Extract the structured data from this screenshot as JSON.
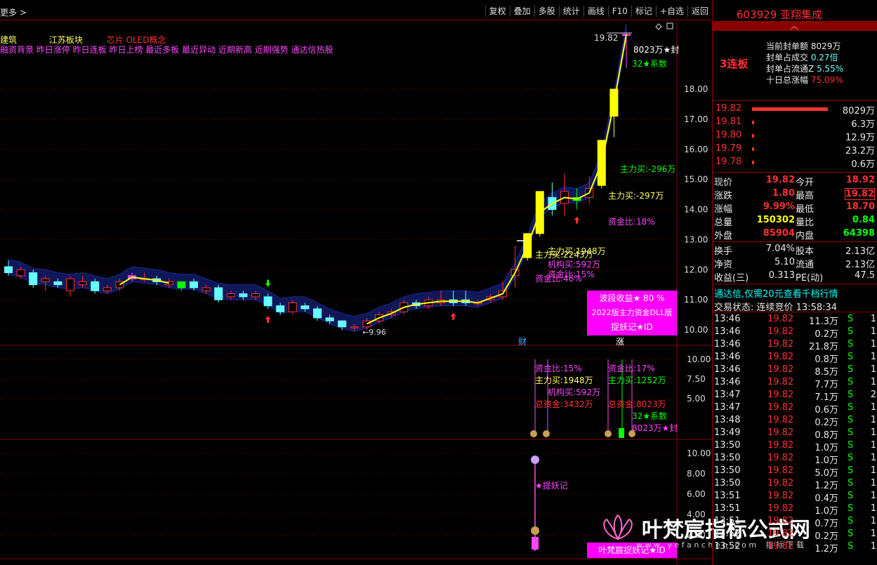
{
  "toolbar": {
    "more_label": "更多 >",
    "buttons": [
      "复权",
      "叠加",
      "多股",
      "统计",
      "画线",
      "F10",
      "标记",
      "+自选",
      "返回"
    ]
  },
  "chart": {
    "tags_row1": [
      "建筑",
      "江苏板块",
      "芯片 OLED概念"
    ],
    "tags_row2": "融资背景 昨日涨停 昨日连板 昨日上榜 最近多板 最近异动 近期新高 近期强势 通达信热股",
    "y_main_ticks": [
      "18.00",
      "17.00",
      "16.00",
      "15.00",
      "14.00",
      "13.00",
      "12.00",
      "11.00",
      "10.00"
    ],
    "y_mid_ticks": [
      "10.00",
      "7.50",
      "5.00"
    ],
    "y_bottom_ticks": [
      "10.00",
      "8.00",
      "6.00",
      "4.00",
      "2.00"
    ],
    "labels": {
      "high_price": "19.82",
      "seal_amount": "8023万★封",
      "coefficient": "32★系数",
      "low_price": "←9.96",
      "main_buy_1": "主力买:-296万",
      "main_buy_2": "主力买:-297万",
      "fund_ratio_1": "资金比:18%",
      "main_buy_3": "主力买:2243万",
      "main_buy_4": "主力买:1948万",
      "inst_buy": "机构买:592万",
      "fund_ratio_2": "资金比:15%",
      "fund_ratio_3": "资金比:46%",
      "cai": "财",
      "zhang": "涨",
      "mid_fund": "资金比:15%",
      "mid_main": "主力买:1948万",
      "mid_inst": "机构买:592万",
      "mid_total": "总资金:3432万",
      "mid_fund2": "资金比:17%",
      "mid_main2": "主力买:1252万",
      "mid_total2": "总资金:8023万",
      "mid_coef": "32★系数",
      "mid_seal": "8023万★封",
      "tiyao": "★提妖记"
    },
    "pinkbox": {
      "line1": "波段收益★ 80 %",
      "line2": "2022版主力资金DLL版",
      "line3": "捉妖记★ID"
    },
    "bottom_box": "叶梵宸捉妖记★ID",
    "watermark": "叶梵宸指标公式网",
    "watermark_sub": "w w w . y e f a n c h e n . c o m",
    "watermark_sub2": "指 标 下 载"
  },
  "chart_data": {
    "type": "candlestick",
    "ylim": [
      9.6,
      20.2
    ],
    "candles": [
      {
        "o": 11.9,
        "c": 12.1,
        "h": 12.3,
        "l": 11.8,
        "col": "cyan"
      },
      {
        "o": 11.8,
        "c": 12.0,
        "h": 12.1,
        "l": 11.7,
        "col": "red"
      },
      {
        "o": 11.9,
        "c": 11.5,
        "h": 12.0,
        "l": 11.4,
        "col": "cyan"
      },
      {
        "o": 11.6,
        "c": 11.7,
        "h": 11.8,
        "l": 11.3,
        "col": "red"
      },
      {
        "o": 11.6,
        "c": 11.5,
        "h": 11.7,
        "l": 11.4,
        "col": "cyan"
      },
      {
        "o": 11.7,
        "c": 11.3,
        "h": 11.8,
        "l": 11.1,
        "col": "red"
      },
      {
        "o": 11.5,
        "c": 11.6,
        "h": 11.8,
        "l": 11.4,
        "col": "red"
      },
      {
        "o": 11.6,
        "c": 11.3,
        "h": 11.7,
        "l": 11.2,
        "col": "cyan"
      },
      {
        "o": 11.4,
        "c": 11.3,
        "h": 11.5,
        "l": 11.2,
        "col": "red"
      },
      {
        "o": 11.4,
        "c": 11.6,
        "h": 11.7,
        "l": 11.3,
        "col": "red"
      },
      {
        "o": 11.7,
        "c": 11.8,
        "h": 11.9,
        "l": 11.6,
        "col": "magenta"
      },
      {
        "o": 11.7,
        "c": 11.7,
        "h": 11.9,
        "l": 11.6,
        "col": "red"
      },
      {
        "o": 11.7,
        "c": 11.6,
        "h": 11.8,
        "l": 11.5,
        "col": "cyan"
      },
      {
        "o": 11.6,
        "c": 11.5,
        "h": 11.7,
        "l": 11.4,
        "col": "red"
      },
      {
        "o": 11.6,
        "c": 11.4,
        "h": 11.6,
        "l": 11.3,
        "col": "green"
      },
      {
        "o": 11.6,
        "c": 11.4,
        "h": 11.7,
        "l": 11.3,
        "col": "cyan"
      },
      {
        "o": 11.4,
        "c": 11.3,
        "h": 11.5,
        "l": 11.2,
        "col": "red"
      },
      {
        "o": 11.4,
        "c": 11.0,
        "h": 11.5,
        "l": 10.9,
        "col": "cyan"
      },
      {
        "o": 11.1,
        "c": 11.2,
        "h": 11.3,
        "l": 11.0,
        "col": "red"
      },
      {
        "o": 11.2,
        "c": 11.1,
        "h": 11.3,
        "l": 11.0,
        "col": "cyan"
      },
      {
        "o": 11.2,
        "c": 11.1,
        "h": 11.3,
        "l": 11.0,
        "col": "red"
      },
      {
        "o": 11.1,
        "c": 10.8,
        "h": 11.2,
        "l": 10.7,
        "col": "cyan"
      },
      {
        "o": 10.8,
        "c": 10.6,
        "h": 10.9,
        "l": 10.5,
        "col": "cyan"
      },
      {
        "o": 10.6,
        "c": 10.9,
        "h": 11.0,
        "l": 10.5,
        "col": "red"
      },
      {
        "o": 10.8,
        "c": 10.7,
        "h": 10.9,
        "l": 10.6,
        "col": "cyan"
      },
      {
        "o": 10.7,
        "c": 10.4,
        "h": 10.8,
        "l": 10.3,
        "col": "cyan"
      },
      {
        "o": 10.4,
        "c": 10.3,
        "h": 10.5,
        "l": 10.2,
        "col": "cyan"
      },
      {
        "o": 10.3,
        "c": 10.1,
        "h": 10.3,
        "l": 10.0,
        "col": "cyan"
      },
      {
        "o": 10.1,
        "c": 10.1,
        "h": 10.2,
        "l": 9.96,
        "col": "red"
      },
      {
        "o": 10.1,
        "c": 10.3,
        "h": 10.4,
        "l": 10.0,
        "col": "red"
      },
      {
        "o": 10.3,
        "c": 10.5,
        "h": 10.6,
        "l": 10.2,
        "col": "red"
      },
      {
        "o": 10.5,
        "c": 10.6,
        "h": 10.7,
        "l": 10.4,
        "col": "red"
      },
      {
        "o": 10.6,
        "c": 10.9,
        "h": 11.0,
        "l": 10.5,
        "col": "red"
      },
      {
        "o": 10.9,
        "c": 10.8,
        "h": 11.0,
        "l": 10.7,
        "col": "cyan"
      },
      {
        "o": 10.8,
        "c": 11.0,
        "h": 11.1,
        "l": 10.7,
        "col": "red"
      },
      {
        "o": 10.9,
        "c": 11.0,
        "h": 11.3,
        "l": 10.8,
        "col": "red"
      },
      {
        "o": 11.0,
        "c": 10.9,
        "h": 11.3,
        "l": 10.8,
        "col": "cyan"
      },
      {
        "o": 11.0,
        "c": 10.9,
        "h": 11.3,
        "l": 10.8,
        "col": "cyan"
      },
      {
        "o": 10.9,
        "c": 10.9,
        "h": 11.0,
        "l": 10.8,
        "col": "red"
      },
      {
        "o": 11.0,
        "c": 11.1,
        "h": 11.2,
        "l": 10.9,
        "col": "red"
      },
      {
        "o": 11.1,
        "c": 11.3,
        "h": 11.6,
        "l": 11.0,
        "col": "red"
      },
      {
        "o": 11.8,
        "c": 12.0,
        "h": 12.8,
        "l": 11.4,
        "col": "red"
      },
      {
        "o": 12.4,
        "c": 13.2,
        "h": 13.2,
        "l": 12.3,
        "col": "yellow"
      },
      {
        "o": 13.2,
        "c": 14.6,
        "h": 14.6,
        "l": 13.1,
        "col": "yellow"
      },
      {
        "o": 14.4,
        "c": 14.0,
        "h": 14.9,
        "l": 13.8,
        "col": "cyan"
      },
      {
        "o": 14.2,
        "c": 14.6,
        "h": 15.2,
        "l": 13.8,
        "col": "red"
      },
      {
        "o": 14.4,
        "c": 14.3,
        "h": 14.7,
        "l": 14.0,
        "col": "green"
      },
      {
        "o": 14.4,
        "c": 14.7,
        "h": 15.1,
        "l": 14.2,
        "col": "red"
      },
      {
        "o": 14.8,
        "c": 16.3,
        "h": 16.3,
        "l": 14.7,
        "col": "yellow"
      },
      {
        "o": 17.1,
        "c": 18.0,
        "h": 18.0,
        "l": 16.4,
        "col": "yellow"
      },
      {
        "o": 19.82,
        "c": 19.82,
        "h": 19.82,
        "l": 18.7,
        "col": "magenta"
      }
    ]
  },
  "panel": {
    "code": "603929",
    "name": "亚翔集成",
    "board_count": "3连板",
    "seal_label": "当前封单额",
    "seal_value": "8029万",
    "deal_ratio_label": "封单占成交",
    "deal_ratio_value": "0.27倍",
    "float_ratio_label": "封单占流通Z",
    "float_ratio_value": "5.55%",
    "ten_day_label": "十日总涨幅",
    "ten_day_value": "75.09%",
    "order_book": [
      {
        "price": "19.82",
        "bar": 1.0,
        "vol": "8029万"
      },
      {
        "price": "19.81",
        "bar": 0.01,
        "vol": "6.3万"
      },
      {
        "price": "19.80",
        "bar": 0.01,
        "vol": "12.9万"
      },
      {
        "price": "19.79",
        "bar": 0.01,
        "vol": "23.2万"
      },
      {
        "price": "19.78",
        "bar": 0.01,
        "vol": "0.6万"
      }
    ],
    "quote": [
      {
        "l1": "现价",
        "v1": "19.82",
        "c1": "red",
        "l2": "今开",
        "v2": "18.92",
        "c2": "red"
      },
      {
        "l1": "涨跌",
        "v1": "1.80",
        "c1": "red",
        "l2": "最高",
        "v2": "19.82",
        "c2": "red"
      },
      {
        "l1": "涨幅",
        "v1": "9.99%",
        "c1": "red",
        "l2": "最低",
        "v2": "18.70",
        "c2": "red"
      },
      {
        "l1": "总量",
        "v1": "150302",
        "c1": "yellow",
        "l2": "量比",
        "v2": "0.84",
        "c2": "green"
      },
      {
        "l1": "外盘",
        "v1": "85904",
        "c1": "red",
        "l2": "内盘",
        "v2": "64398",
        "c2": "green"
      }
    ],
    "fund": [
      {
        "l1": "换手",
        "v1": "7.04%",
        "l2": "股本",
        "v2": "2.13亿"
      },
      {
        "l1": "净资",
        "v1": "5.10",
        "l2": "流通",
        "v2": "2.13亿"
      },
      {
        "l1": "收益(三)",
        "v1": "0.313",
        "l2": "PE(动)",
        "v2": "47.5"
      }
    ],
    "promo": "通达信,仅需20元查看千档行情",
    "status_label": "交易状态: 连续竞价",
    "status_time": "13:58:34",
    "ticks": [
      {
        "t": "13:46",
        "p": "19.82",
        "v": "11.3万",
        "s": "S",
        "n": "1"
      },
      {
        "t": "13:46",
        "p": "19.82",
        "v": "0.2万",
        "s": "S",
        "n": "1"
      },
      {
        "t": "13:46",
        "p": "19.82",
        "v": "21.8万",
        "s": "S",
        "n": "1"
      },
      {
        "t": "13:46",
        "p": "19.82",
        "v": "0.8万",
        "s": "S",
        "n": "1"
      },
      {
        "t": "13:46",
        "p": "19.82",
        "v": "8.5万",
        "s": "S",
        "n": "1"
      },
      {
        "t": "13:46",
        "p": "19.82",
        "v": "7.7万",
        "s": "S",
        "n": "1"
      },
      {
        "t": "13:47",
        "p": "19.82",
        "v": "7.1万",
        "s": "S",
        "n": "2"
      },
      {
        "t": "13:47",
        "p": "19.82",
        "v": "0.6万",
        "s": "S",
        "n": "1"
      },
      {
        "t": "13:48",
        "p": "19.82",
        "v": "0.2万",
        "s": "S",
        "n": "1"
      },
      {
        "t": "13:49",
        "p": "19.82",
        "v": "0.8万",
        "s": "S",
        "n": "1"
      },
      {
        "t": "13:50",
        "p": "19.82",
        "v": "1.0万",
        "s": "S",
        "n": "1"
      },
      {
        "t": "13:50",
        "p": "19.82",
        "v": "1.0万",
        "s": "S",
        "n": "1"
      },
      {
        "t": "13:50",
        "p": "19.82",
        "v": "5.0万",
        "s": "S",
        "n": "1"
      },
      {
        "t": "13:50",
        "p": "19.82",
        "v": "1.2万",
        "s": "S",
        "n": "1"
      },
      {
        "t": "13:51",
        "p": "19.82",
        "v": "0.4万",
        "s": "S",
        "n": "1"
      },
      {
        "t": "13:51",
        "p": "19.82",
        "v": "1.0万",
        "s": "S",
        "n": "1"
      },
      {
        "t": "13:51",
        "p": "19.82",
        "v": "0.7万",
        "s": "S",
        "n": "1"
      },
      {
        "t": "13:52",
        "p": "19.82",
        "v": "0.2万",
        "s": "S",
        "n": "1"
      },
      {
        "t": "13:52",
        "p": "19.82",
        "v": "1.2万",
        "s": "S",
        "n": "1"
      }
    ]
  }
}
